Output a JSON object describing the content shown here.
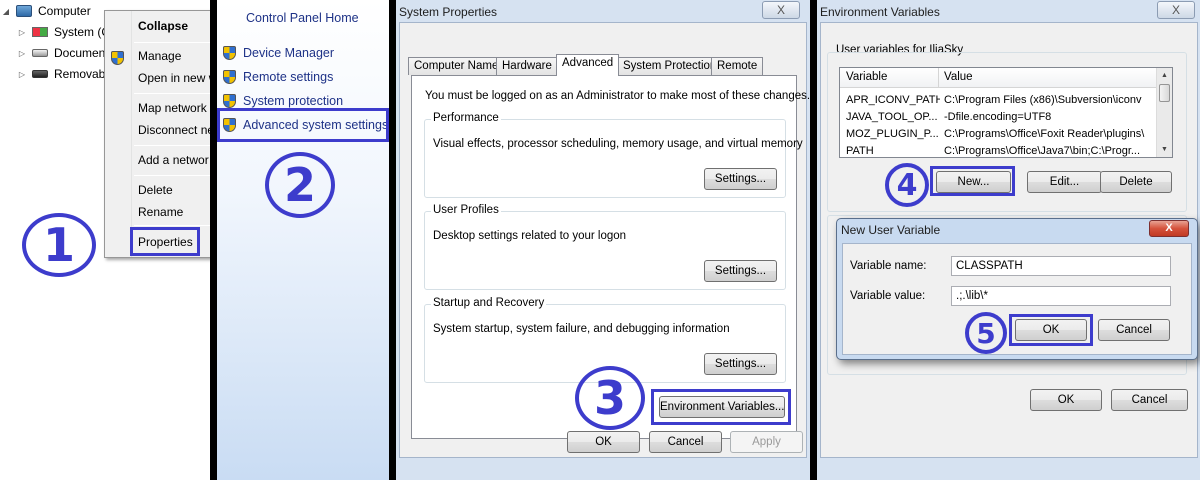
{
  "panel1": {
    "tree": [
      "Computer",
      "System (C",
      "Documen",
      "Removab"
    ],
    "context_menu": [
      "Collapse",
      "Manage",
      "Open in new w",
      "Map network",
      "Disconnect ne",
      "Add a networ",
      "Delete",
      "Rename",
      "Properties"
    ],
    "step_number": "1"
  },
  "panel2": {
    "home_link": "Control Panel Home",
    "tasks": [
      "Device Manager",
      "Remote settings",
      "System protection",
      "Advanced system settings"
    ],
    "step_number": "2"
  },
  "panel3": {
    "title": "System Properties",
    "close": "X",
    "tabs": [
      "Computer Name",
      "Hardware",
      "Advanced",
      "System Protection",
      "Remote"
    ],
    "admin_note": "You must be logged on as an Administrator to make most of these changes.",
    "groups": [
      {
        "label": "Performance",
        "desc": "Visual effects, processor scheduling, memory usage, and virtual memory",
        "button": "Settings..."
      },
      {
        "label": "User Profiles",
        "desc": "Desktop settings related to your logon",
        "button": "Settings..."
      },
      {
        "label": "Startup and Recovery",
        "desc": "System startup, system failure, and debugging information",
        "button": "Settings..."
      }
    ],
    "env_button": "Environment Variables...",
    "ok": "OK",
    "cancel": "Cancel",
    "apply": "Apply",
    "step_number": "3"
  },
  "panel4": {
    "title": "Environment Variables",
    "close": "X",
    "user_vars_label": "User variables for IliaSky",
    "columns": [
      "Variable",
      "Value"
    ],
    "rows": [
      {
        "variable": "APR_ICONV_PATH",
        "value": "C:\\Program Files (x86)\\Subversion\\iconv"
      },
      {
        "variable": "JAVA_TOOL_OP...",
        "value": "-Dfile.encoding=UTF8"
      },
      {
        "variable": "MOZ_PLUGIN_P...",
        "value": "C:\\Programs\\Office\\Foxit Reader\\plugins\\"
      },
      {
        "variable": "PATH",
        "value": "C:\\Programs\\Office\\Java7\\bin;C:\\Progr..."
      }
    ],
    "buttons": [
      "New...",
      "Edit...",
      "Delete"
    ],
    "ok": "OK",
    "cancel": "Cancel",
    "step_number": "4",
    "new_var_dialog": {
      "title": "New User Variable",
      "close": "X",
      "name_label": "Variable name:",
      "name_value": "CLASSPATH",
      "value_label": "Variable value:",
      "value_value": ".;.\\lib\\*",
      "ok": "OK",
      "cancel": "Cancel",
      "step_number": "5"
    }
  },
  "colors": {
    "annotation": "#3d3ccc",
    "link": "#1e3287"
  }
}
